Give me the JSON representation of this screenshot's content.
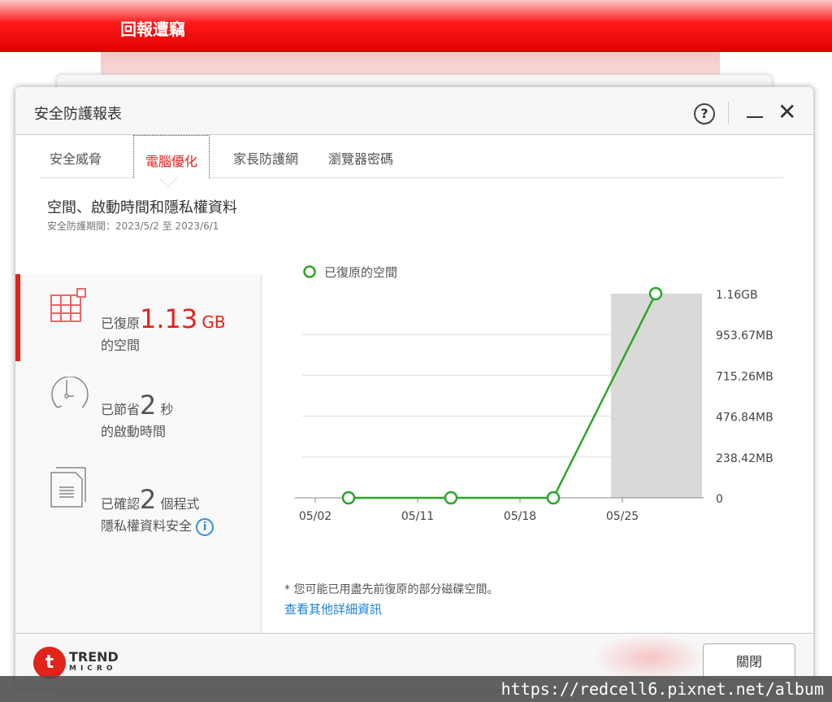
{
  "background": {
    "title": "回報遭竊"
  },
  "dialog": {
    "title": "安全防護報表",
    "help": "?",
    "close_icon": "✕"
  },
  "tabs": [
    "安全威脅",
    "電腦優化",
    "家長防護網",
    "瀏覽器密碼"
  ],
  "section": {
    "title": "空間、啟動時間和隱私權資料",
    "period": "安全防護期間：2023/5/2 至 2023/6/1"
  },
  "items": [
    {
      "pre": "已復原",
      "value": "1.13",
      "unit": "GB",
      "line2": "的空間"
    },
    {
      "pre": "已節省",
      "value": "2",
      "unit": "秒",
      "line2": "的啟動時間"
    },
    {
      "pre": "已確認",
      "value": "2",
      "unit": "個程式",
      "line2": "隱私權資料安全"
    }
  ],
  "chart_data": {
    "type": "line",
    "legend": "已復原的空間",
    "categories": [
      "05/02",
      "05/11",
      "05/18",
      "05/25"
    ],
    "series": [
      {
        "name": "已復原的空間",
        "values_gb": [
          0,
          0,
          0,
          1.16
        ]
      }
    ],
    "yticks": [
      "0",
      "238.42MB",
      "476.84MB",
      "715.26MB",
      "953.67MB",
      "1.16GB"
    ],
    "ylim_gb": [
      0,
      1.16
    ],
    "highlight_category": "05/25",
    "color": "#2aa52a"
  },
  "note": "* 您可能已用盡先前復原的部分磁碟空間。",
  "link": "查看其他詳細資訊",
  "footer": {
    "close": "關閉",
    "logo_top": "TREND",
    "logo_bottom": "MICRO"
  },
  "watermark": "https://redcell6.pixnet.net/album"
}
